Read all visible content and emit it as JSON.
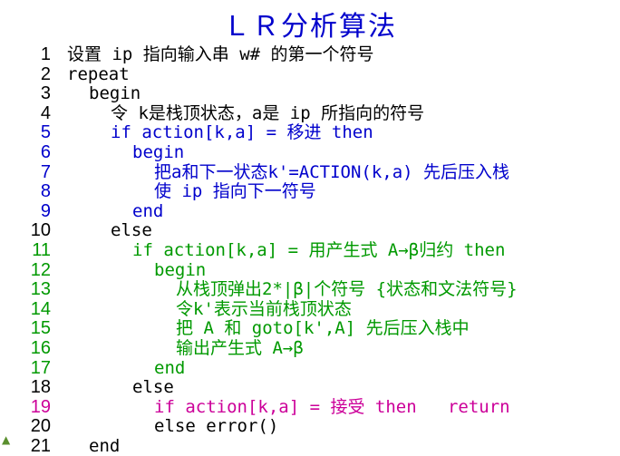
{
  "title": "ＬＲ分析算法",
  "colors": {
    "black": "#000000",
    "blue": "#0000cc",
    "green": "#009900",
    "magenta": "#cc0099"
  },
  "lines": [
    {
      "num": "1",
      "indent": 0,
      "color": "black",
      "text": "设置 ip 指向输入串 w# 的第一个符号"
    },
    {
      "num": "2",
      "indent": 0,
      "color": "black",
      "text": "repeat"
    },
    {
      "num": "3",
      "indent": 2,
      "color": "black",
      "text": "begin"
    },
    {
      "num": "4",
      "indent": 4,
      "color": "black",
      "text": "令 k是栈顶状态，a是 ip 所指向的符号"
    },
    {
      "num": "5",
      "indent": 4,
      "color": "blue",
      "text": "if action[k,a] = 移进 then"
    },
    {
      "num": "6",
      "indent": 6,
      "color": "blue",
      "text": "begin"
    },
    {
      "num": "7",
      "indent": 8,
      "color": "blue",
      "text": "把a和下一状态k'=ACTION(k,a) 先后压入栈"
    },
    {
      "num": "8",
      "indent": 8,
      "color": "blue",
      "text": "使 ip 指向下一符号"
    },
    {
      "num": "9",
      "indent": 6,
      "color": "blue",
      "text": "end"
    },
    {
      "num": "10",
      "indent": 4,
      "color": "black",
      "text": "else"
    },
    {
      "num": "11",
      "indent": 6,
      "color": "green",
      "text": "if action[k,a] = 用产生式 A→β归约 then"
    },
    {
      "num": "12",
      "indent": 8,
      "color": "green",
      "text": "begin"
    },
    {
      "num": "13",
      "indent": 10,
      "color": "green",
      "text": "从栈顶弹出2*|β|个符号 {状态和文法符号}"
    },
    {
      "num": "14",
      "indent": 10,
      "color": "green",
      "text": "令k'表示当前栈顶状态"
    },
    {
      "num": "15",
      "indent": 10,
      "color": "green",
      "text": "把 A 和 goto[k',A] 先后压入栈中"
    },
    {
      "num": "16",
      "indent": 10,
      "color": "green",
      "text": "输出产生式 A→β"
    },
    {
      "num": "17",
      "indent": 8,
      "color": "green",
      "text": "end"
    },
    {
      "num": "18",
      "indent": 6,
      "color": "black",
      "text": "else"
    },
    {
      "num": "19",
      "indent": 8,
      "color": "magenta",
      "text": "if action[k,a] = 接受 then   return"
    },
    {
      "num": "20",
      "indent": 8,
      "color": "black",
      "text": "else error()"
    },
    {
      "num": "21",
      "indent": 2,
      "color": "black",
      "text": "end"
    }
  ]
}
